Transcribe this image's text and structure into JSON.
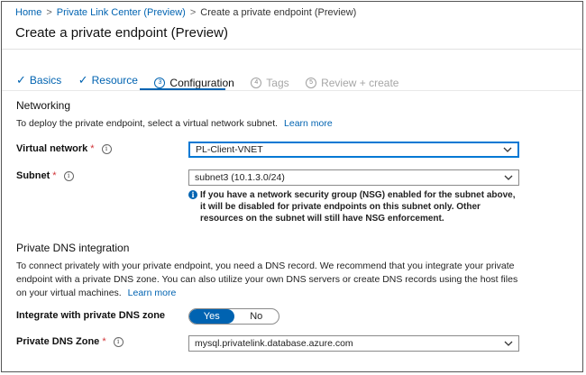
{
  "breadcrumb": {
    "items": [
      "Home",
      "Private Link Center (Preview)",
      "Create a private endpoint (Preview)"
    ],
    "separator": ">"
  },
  "page": {
    "title": "Create a private endpoint (Preview)"
  },
  "tabs": [
    {
      "label": "Basics",
      "state": "completed",
      "icon": "checkmark-icon"
    },
    {
      "label": "Resource",
      "state": "completed",
      "icon": "checkmark-icon"
    },
    {
      "number": "3",
      "label": "Configuration",
      "state": "active"
    },
    {
      "number": "4",
      "label": "Tags",
      "state": "disabled"
    },
    {
      "number": "5",
      "label": "Review + create",
      "state": "disabled"
    }
  ],
  "networking": {
    "heading": "Networking",
    "description": "To deploy the private endpoint, select a virtual network subnet.",
    "learn_more": "Learn more",
    "virtual_network": {
      "label": "Virtual network",
      "required_mark": "*",
      "value": "PL-Client-VNET"
    },
    "subnet": {
      "label": "Subnet",
      "required_mark": "*",
      "value": "subnet3 (10.1.3.0/24)"
    },
    "notice": "If you have a network security group (NSG) enabled for the subnet above, it will be disabled for private endpoints on this subnet only. Other resources on the subnet will still have NSG enforcement."
  },
  "dns": {
    "heading": "Private DNS integration",
    "description": "To connect privately with your private endpoint, you need a DNS record. We recommend that you integrate your private endpoint with a private DNS zone. You can also utilize your own DNS servers or create DNS records using the host files on your virtual machines.",
    "learn_more": "Learn more",
    "integrate": {
      "label": "Integrate with private DNS zone",
      "options": [
        "Yes",
        "No"
      ],
      "selected": "Yes"
    },
    "zone": {
      "label": "Private DNS Zone",
      "required_mark": "*",
      "value": "mysql.privatelink.database.azure.com"
    }
  },
  "colors": {
    "accent": "#0063b1",
    "required": "#d13438",
    "focus_border": "#0078d4"
  },
  "icons": {
    "info": "info-icon",
    "chevron": "chevron-down-icon",
    "check": "checkmark-icon"
  }
}
